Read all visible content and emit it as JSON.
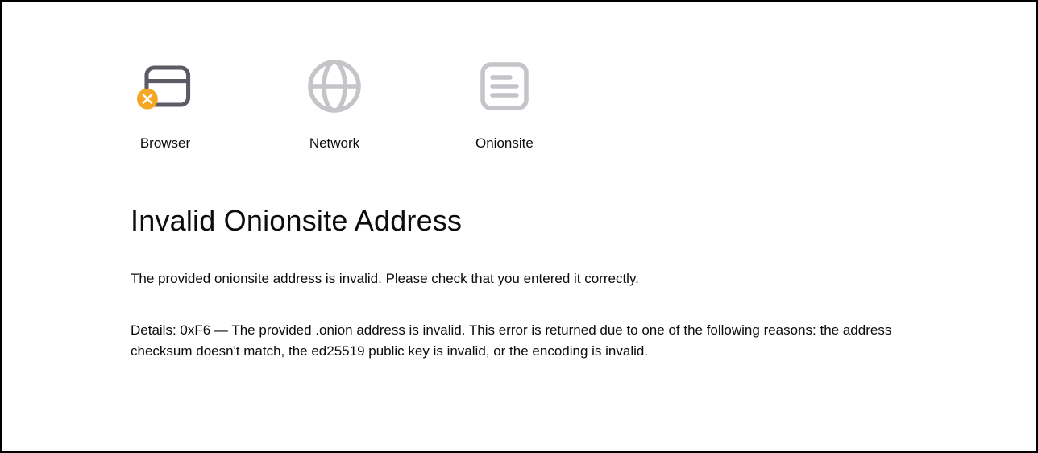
{
  "icons": {
    "browser": {
      "label": "Browser"
    },
    "network": {
      "label": "Network"
    },
    "onionsite": {
      "label": "Onionsite"
    }
  },
  "error": {
    "title": "Invalid Onionsite Address",
    "message": "The provided onionsite address is invalid. Please check that you entered it correctly.",
    "details": "Details: 0xF6 — The provided .onion address is invalid. This error is returned due to one of the following reasons: the address checksum doesn't match, the ed25519 public key is invalid, or the encoding is invalid."
  },
  "colors": {
    "accent": "#f5a623",
    "icon_stroke_dark": "#5b5b66",
    "icon_stroke_light": "#c4c4c9"
  }
}
